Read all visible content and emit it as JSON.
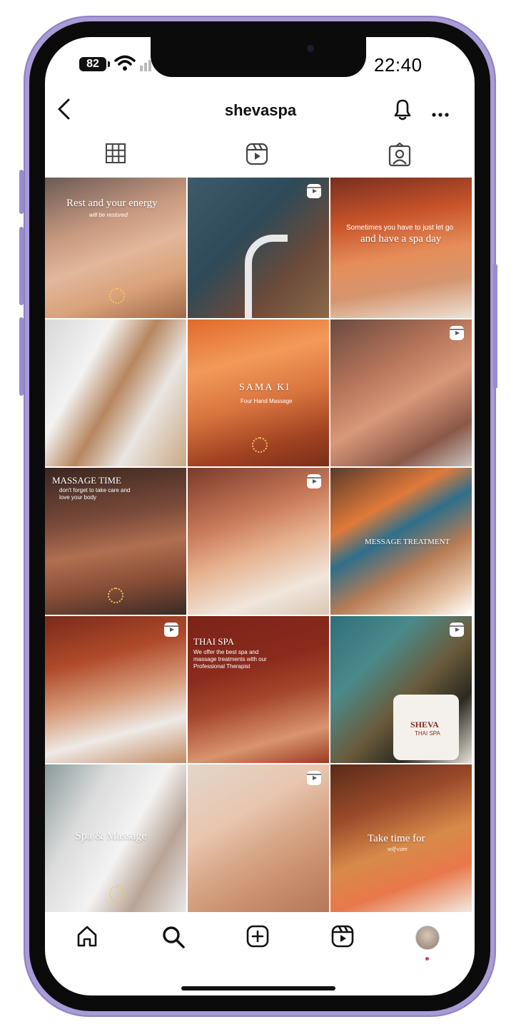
{
  "status_bar": {
    "battery": "82",
    "time": "22:40"
  },
  "header": {
    "username": "shevaspa"
  },
  "icons": {
    "back": "chevron-left-icon",
    "bell": "bell-icon",
    "more": "more-icon",
    "grid_tab": "grid-icon",
    "reels_tab": "reels-icon",
    "tagged_tab": "tagged-icon",
    "reel_badge": "reel-badge-icon",
    "nav_home": "home-icon",
    "nav_search": "search-icon",
    "nav_create": "create-icon",
    "nav_reels": "reels-icon",
    "nav_profile": "avatar"
  },
  "posts": [
    {
      "caption": "Rest and your energy",
      "sub": "will be restored",
      "reel": false
    },
    {
      "caption": "",
      "sub": "",
      "reel": true
    },
    {
      "caption": "and have a spa day",
      "sub": "Sometimes you have to just let go",
      "reel": false
    },
    {
      "caption": "",
      "sub": "",
      "reel": false
    },
    {
      "caption": "SAMA KI",
      "sub": "Four Hand Massage",
      "reel": false
    },
    {
      "caption": "",
      "sub": "",
      "reel": true
    },
    {
      "caption": "MASSAGE TIME",
      "sub": "don't forget to take care and love your body",
      "reel": false
    },
    {
      "caption": "",
      "sub": "",
      "reel": true
    },
    {
      "caption": "MESSAGE TREATMENT",
      "sub": "",
      "reel": false
    },
    {
      "caption": "",
      "sub": "",
      "reel": true
    },
    {
      "caption": "THAI SPA",
      "sub": "We offer the best spa and massage treatments with our Professional Therapist",
      "reel": false
    },
    {
      "caption": "SHEVA",
      "sub": "THAI SPA",
      "reel": true
    },
    {
      "caption": "Spa & Massage",
      "sub": "",
      "reel": false
    },
    {
      "caption": "",
      "sub": "",
      "reel": true
    },
    {
      "caption": "Take time for",
      "sub": "self-care",
      "reel": false
    }
  ],
  "colors": {
    "accent": "#e1306c",
    "frame": "#a99bd6"
  }
}
